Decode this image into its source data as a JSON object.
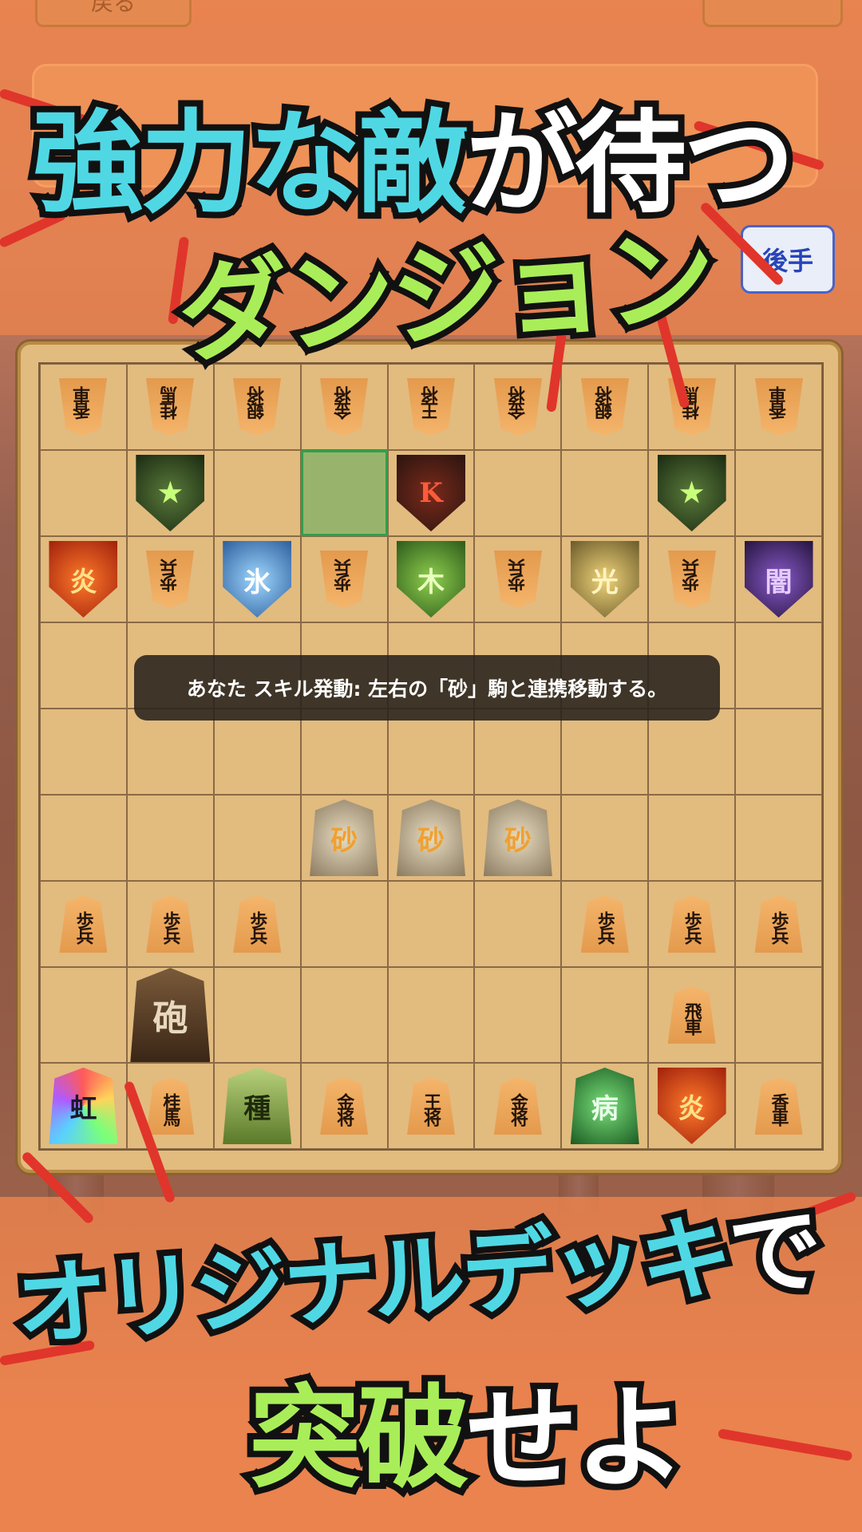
{
  "header": {
    "back_label": "戻る",
    "right_label": "",
    "turn_badge": "後手"
  },
  "headline_top": {
    "line1_cyan": "強力な敵",
    "line1_white": "が待つ",
    "line2_green": "ダンジョン"
  },
  "headline_bottom": {
    "line1_cyan": "オリジナルデッキ",
    "line1_white": "で",
    "line2_green": "突破",
    "line2_white": "せよ"
  },
  "toast": {
    "text": "あなた スキル発動: 左右の「砂」駒と連携移動する。"
  },
  "board": {
    "rows": [
      [
        "香車",
        "桂馬",
        "銀将",
        "金将",
        "王将",
        "金将",
        "銀将",
        "桂馬",
        "香車"
      ],
      [
        "",
        "gob",
        "",
        "",
        "kboss",
        "",
        "",
        "gob",
        ""
      ],
      [
        "炎",
        "歩兵",
        "氷",
        "歩兵",
        "木",
        "歩兵",
        "光",
        "歩兵",
        "闇"
      ],
      [
        "",
        "",
        "",
        "",
        "",
        "",
        "",
        "",
        ""
      ],
      [
        "",
        "",
        "",
        "",
        "",
        "",
        "",
        "",
        ""
      ],
      [
        "",
        "",
        "",
        "砂",
        "砂",
        "砂",
        "",
        "",
        ""
      ],
      [
        "歩兵",
        "歩兵",
        "歩兵",
        "",
        "",
        "",
        "歩兵",
        "歩兵",
        "歩兵"
      ],
      [
        "",
        "砲",
        "",
        "",
        "",
        "",
        "",
        "飛車",
        ""
      ],
      [
        "虹",
        "桂馬",
        "種",
        "金将",
        "王将",
        "金将",
        "病",
        "炎",
        "香車"
      ]
    ]
  },
  "colors": {
    "accent_orange": "#e9814c",
    "headline_cyan": "#4fd8e4",
    "headline_green": "#a9ee58",
    "highlight_green": "#2ea14a"
  }
}
